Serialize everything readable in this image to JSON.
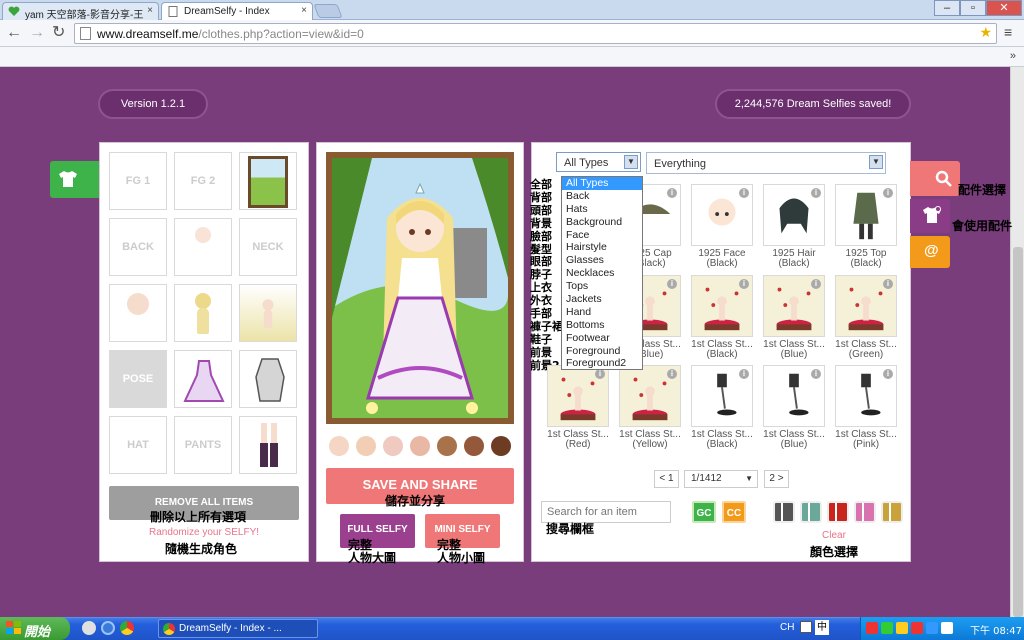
{
  "browser": {
    "tabs": [
      {
        "label": "yam 天空部落-影音分享-王"
      },
      {
        "label": "DreamSelfy - Index"
      }
    ],
    "window_controls": {
      "minimize": "–",
      "maximize": "▫",
      "close": "✕"
    },
    "url_host": "www.dreamself.me",
    "url_path": "/clothes.php?action=view&id=0",
    "more_label": "»"
  },
  "header": {
    "version": "Version 1.2.1",
    "saved_count": "2,244,576 Dream Selfies saved!"
  },
  "slots": [
    {
      "label": "FG 1"
    },
    {
      "label": "FG 2"
    },
    {
      "label": ""
    },
    {
      "label": "BACK"
    },
    {
      "label": ""
    },
    {
      "label": "NECK"
    },
    {
      "label": ""
    },
    {
      "label": ""
    },
    {
      "label": ""
    },
    {
      "label": "POSE"
    },
    {
      "label": ""
    },
    {
      "label": ""
    },
    {
      "label": "HAT"
    },
    {
      "label": "PANTS"
    },
    {
      "label": ""
    }
  ],
  "left_panel": {
    "remove_all": "REMOVE ALL ITEMS",
    "remove_all_note": "刪除以上所有選項",
    "randomize": "Randomize your SELFY!",
    "randomize_note": "隨機生成角色"
  },
  "center_panel": {
    "save_share": "SAVE AND SHARE",
    "save_share_note": "儲存並分享",
    "full_selfy": "FULL SELFY",
    "full_note_1": "完整",
    "full_note_2": "人物大圖",
    "mini_selfy": "MINI SELFY",
    "mini_note_1": "完整",
    "mini_note_2": "人物小圖",
    "skin_tones": [
      "#f5d5c3",
      "#f2cfb4",
      "#f0c9c0",
      "#e9b8a4",
      "#a8724b",
      "#94583b",
      "#6e3b23"
    ]
  },
  "filter": {
    "type_selected": "All Types",
    "everything": "Everything",
    "types": [
      "All Types",
      "Back",
      "Hats",
      "Background",
      "Face",
      "Hairstyle",
      "Glasses",
      "Necklaces",
      "Tops",
      "Jackets",
      "Hand",
      "Bottoms",
      "Footwear",
      "Foreground",
      "Foreground2"
    ],
    "types_zh": [
      "全部",
      "背部",
      "頭部",
      "背景",
      "臉部",
      "髮型",
      "眼部",
      "脖子",
      "上衣",
      "外衣",
      "手部",
      "褲子裙子",
      "鞋子",
      "前景",
      "前景2"
    ]
  },
  "items": [
    {
      "line1": "1925 Cap",
      "line2": "(Black)"
    },
    {
      "line1": "1925 Face",
      "line2": "(Black)"
    },
    {
      "line1": "1925 Hair",
      "line2": "(Black)"
    },
    {
      "line1": "1925 Top",
      "line2": "(Black)"
    },
    {
      "line1": "1st Class St...",
      "line2": "(Blue)"
    },
    {
      "line1": "1st Class St...",
      "line2": "(Black)"
    },
    {
      "line1": "1st Class St...",
      "line2": "(Blue)"
    },
    {
      "line1": "1st Class St...",
      "line2": "(Green)"
    },
    {
      "line1": "1st Class St...",
      "line2": "(Red)"
    },
    {
      "line1": "1st Class St...",
      "line2": "(Yellow)"
    },
    {
      "line1": "1st Class St...",
      "line2": "(Black)"
    },
    {
      "line1": "1st Class St...",
      "line2": "(Blue)"
    },
    {
      "line1": "1st Class St...",
      "line2": "(Pink)"
    }
  ],
  "pager": {
    "prev": "< 1",
    "current": "1/1412",
    "next": "2 >"
  },
  "search": {
    "placeholder": "Search for an item",
    "note": "搜尋欄框",
    "gc": "GC",
    "cc": "CC",
    "clear": "Clear",
    "color_note": "顏色選擇"
  },
  "color_swatches": [
    "#555555",
    "#6aa89a",
    "#c9251f",
    "#d873b0",
    "#c9a23a"
  ],
  "side_icons": {
    "accessory_note": "配件選擇",
    "used_note": "會使用配件"
  },
  "taskbar": {
    "start": "開始",
    "window": "DreamSelfy - Index - ...",
    "lang": "CH",
    "ime": "中",
    "clock": "下午 08:47"
  }
}
